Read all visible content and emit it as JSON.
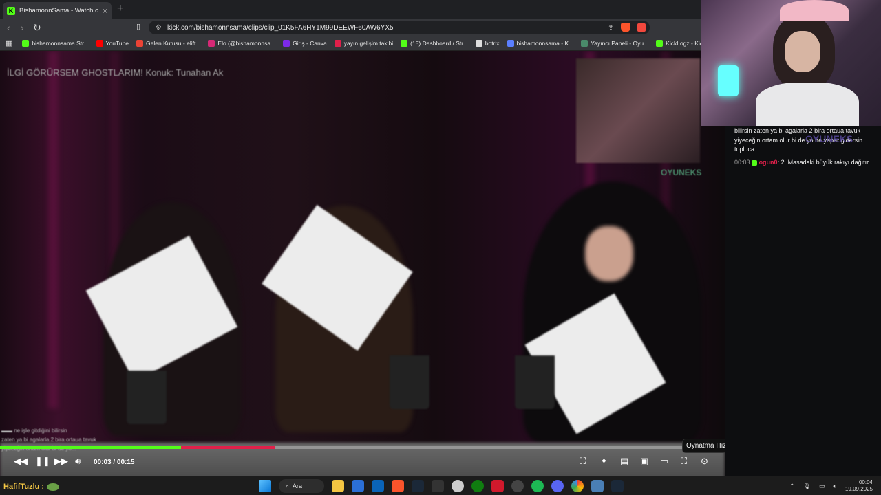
{
  "browser": {
    "tab_title": "BishamonnSama - Watch clips o",
    "new_tab": "+",
    "close": "×",
    "url": "kick.com/bishamonnsama/clips/clip_01K5FA6HY1M99DEEWF60AW6YX5",
    "bookmarks": [
      {
        "label": "bishamonnsama Str...",
        "color": "#53fc18"
      },
      {
        "label": "YouTube",
        "color": "#ff0000"
      },
      {
        "label": "Gelen Kutusu - elift...",
        "color": "#ea4335"
      },
      {
        "label": "Elo (@bishamonnsa...",
        "color": "#d62976"
      },
      {
        "label": "Giriş - Canva",
        "color": "#7d2ae8"
      },
      {
        "label": "yayın gelişim takibi",
        "color": "#e0204a"
      },
      {
        "label": "(15) Dashboard / Str...",
        "color": "#53fc18"
      },
      {
        "label": "botrix",
        "color": "#dddddd"
      },
      {
        "label": "bishamonnsama - K...",
        "color": "#5b7fff"
      },
      {
        "label": "Yayıncı Paneli - Oyu...",
        "color": "#4a8a6a"
      },
      {
        "label": "KickLogz - Kick Yayı...",
        "color": "#53fc18"
      }
    ]
  },
  "video": {
    "title": "İLGİ GÖRÜRSEM GHOSTLARIM! Konuk: Tunahan Ak",
    "time_current": "00:03",
    "time_total": "00:15",
    "time_display": "00:03 / 00:15",
    "progress_fraction": 0.25,
    "overlay_brand": "OYUNEKS",
    "tooltip": "Oynatma Hızı",
    "accent": "#53fc18"
  },
  "chat": {
    "messages": [
      {
        "ts": "",
        "user": "",
        "text": "bilirsin zaten ya bi agalarla 2 bira ortaua tavuk yiyeceğin ortam olur bi de yo ne yapar gidersin topluca"
      },
      {
        "ts": "00:03",
        "user": "ogun0",
        "text": ": 2. Masadaki büyük rakıyı dağıtır"
      }
    ],
    "watermark": "OYUNEKS"
  },
  "taskbar": {
    "user_label": "HafifTuzlu :",
    "search_label": "Ara",
    "time": "00:04",
    "date": "19.09.2025"
  }
}
